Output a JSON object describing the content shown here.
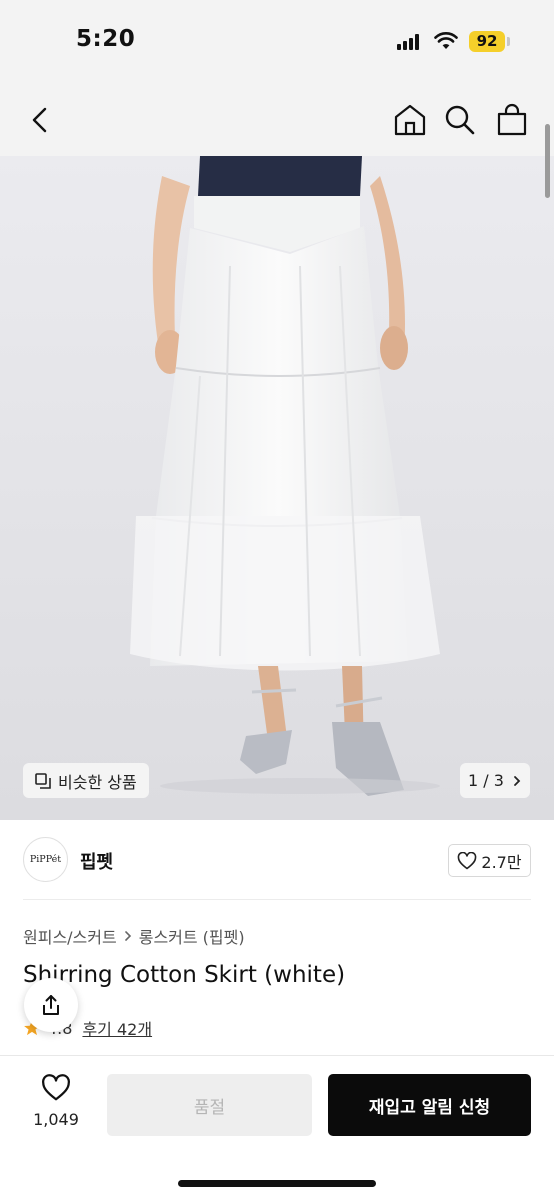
{
  "status_bar": {
    "time": "5:20",
    "battery": "92",
    "battery_color": "#f5cf2a"
  },
  "nav": {
    "icons": [
      "back-icon",
      "home-icon",
      "search-icon",
      "shopping-bag-icon"
    ]
  },
  "hero": {
    "similar_label": "비슷한 상품",
    "page_counter": "1 / 3"
  },
  "brand": {
    "logo_text": "PiPPét",
    "name": "핍펫",
    "likes": "2.7만"
  },
  "product": {
    "breadcrumb": [
      "원피스/스커트",
      "롱스커트 (핍펫)"
    ],
    "title": "Shirring Cotton Skirt (white)",
    "rating": "4.8",
    "reviews": "후기 42개"
  },
  "bottom_bar": {
    "wish_count": "1,049",
    "soldout_label": "품절",
    "restock_label": "재입고 알림 신청"
  },
  "colors": {
    "accent_black": "#0b0b0b",
    "star": "#f5a623"
  }
}
